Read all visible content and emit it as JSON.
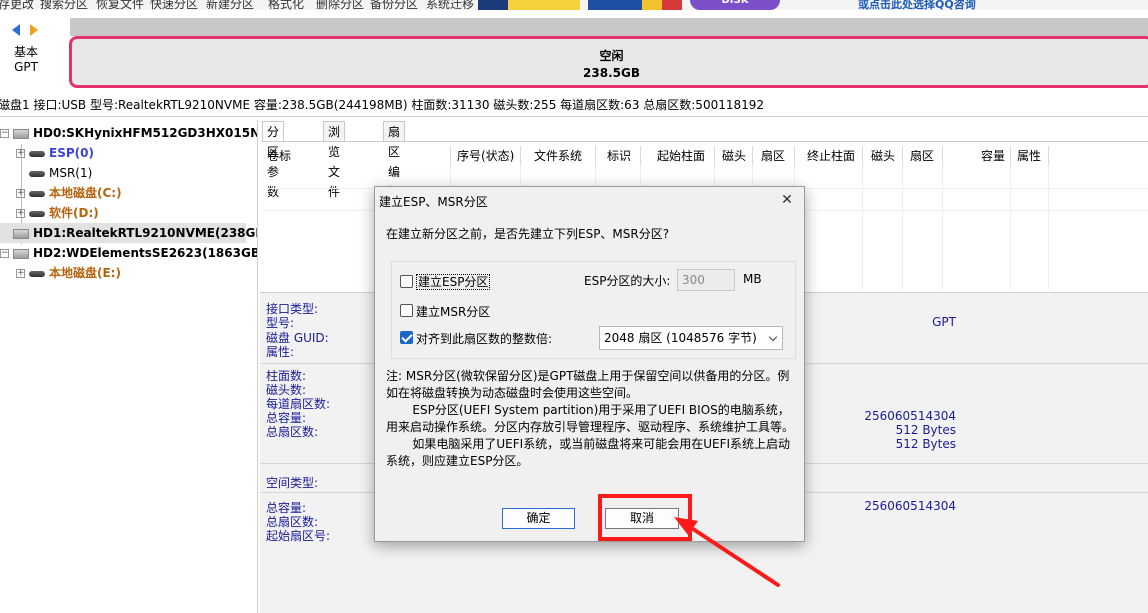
{
  "toolbar": {
    "items": [
      "存更改",
      "搜索分区",
      "恢复文件",
      "快速分区",
      "新建分区",
      "格式化",
      "删除分区",
      "备份分区",
      "系统迁移"
    ],
    "qq_text": "或点击此处选择QQ咨询",
    "banner_disk": "DISK"
  },
  "disk_nav": {
    "type": "基本",
    "style": "GPT"
  },
  "partition_bar": {
    "label": "空闲",
    "size": "238.5GB"
  },
  "disk_info": "磁盘1 接口:USB  型号:RealtekRTL9210NVME  容量:238.5GB(244198MB)  柱面数:31130  磁头数:255  每道扇区数:63  总扇区数:500118192",
  "tree": {
    "items": [
      {
        "label": "HD0:SKHynixHFM512GD3HX015N(47",
        "kind": "disk"
      },
      {
        "label": "ESP(0)",
        "kind": "partition",
        "color": "#3b44d6"
      },
      {
        "label": "MSR(1)",
        "kind": "partition",
        "color": "#333333"
      },
      {
        "label": "本地磁盘(C:)",
        "kind": "partition",
        "color": "#b5650f"
      },
      {
        "label": "软件(D:)",
        "kind": "partition",
        "color": "#b5650f"
      },
      {
        "label": "HD1:RealtekRTL9210NVME(238GB)",
        "kind": "disk"
      },
      {
        "label": "HD2:WDElementsSE2623(1863GB)",
        "kind": "disk"
      },
      {
        "label": "本地磁盘(E:)",
        "kind": "partition",
        "color": "#b5650f"
      }
    ]
  },
  "tabs": [
    "分区参数",
    "浏览文件",
    "扇区编辑"
  ],
  "columns": [
    "卷标",
    "序号(状态)",
    "文件系统",
    "标识",
    "起始柱面",
    "磁头",
    "扇区",
    "终止柱面",
    "磁头",
    "扇区",
    "容量",
    "属性"
  ],
  "details": {
    "labels_a": [
      "接口类型:",
      "型号:",
      "磁盘 GUID:",
      "属性:"
    ],
    "labels_b": [
      "柱面数:",
      "磁头数:",
      "每道扇区数:",
      "总容量:",
      "总扇区数:"
    ],
    "labels_c": [
      "空间类型:"
    ],
    "labels_d": [
      "总容量:",
      "总扇区数:",
      "起始扇区号:"
    ],
    "value_gpt": "GPT",
    "value_total_bytes": "256060514304",
    "value_sector_a": "512 Bytes",
    "value_sector_b": "512 Bytes",
    "value_total_bytes_2": "256060514304"
  },
  "dialog": {
    "title": "建立ESP、MSR分区",
    "close": "✕",
    "question": "在建立新分区之前，是否先建立下列ESP、MSR分区?",
    "esp_label": "建立ESP分区",
    "esp_size_label": "ESP分区的大小:",
    "esp_size_value": "300",
    "esp_size_unit": "MB",
    "msr_label": "建立MSR分区",
    "align_label": "对齐到此扇区数的整数倍:",
    "align_value": "2048 扇区 (1048576 字节)",
    "note_1": "注: MSR分区(微软保留分区)是GPT磁盘上用于保留空间以供备用的分区。例如在将磁盘转换为动态磁盘时会使用这些空间。",
    "note_2": "ESP分区(UEFI System partition)用于采用了UEFI BIOS的电脑系统，用来启动操作系统。分区内存放引导管理程序、驱动程序、系统维护工具等。",
    "note_3": "如果电脑采用了UEFI系统，或当前磁盘将来可能会用在UEFI系统上启动系统，则应建立ESP分区。",
    "ok": "确定",
    "cancel": "取消"
  }
}
